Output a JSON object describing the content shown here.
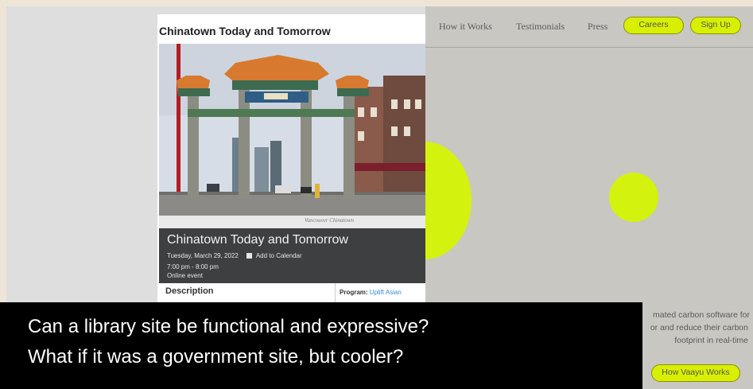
{
  "library_card": {
    "title": "Chinatown Today and Tomorrow",
    "photo_caption": "Vancouver Chinatown",
    "event_title": "Chinatown Today and Tomorrow",
    "event_date": "Tuesday, March 29, 2022",
    "add_to_calendar": "Add to Calendar",
    "event_time": "7:00 pm - 8:00 pm",
    "event_mode": "Online event",
    "description_heading": "Description",
    "program_label": "Program:",
    "program_value": "Uplift Asian"
  },
  "carbon_site": {
    "nav": [
      "How it Works",
      "Testimonials",
      "Press"
    ],
    "careers_button": "Careers",
    "signup_button": "Sign Up",
    "blurb_lines": [
      "mated carbon software for",
      "or and reduce their carbon",
      "footprint in real-time"
    ],
    "cta_button": "How Vaayu Works",
    "accent_color": "#d3f20e"
  },
  "overlay_caption": {
    "line1": "Can a library site be functional and expressive?",
    "line2": "What if it was a government site, but cooler?"
  }
}
